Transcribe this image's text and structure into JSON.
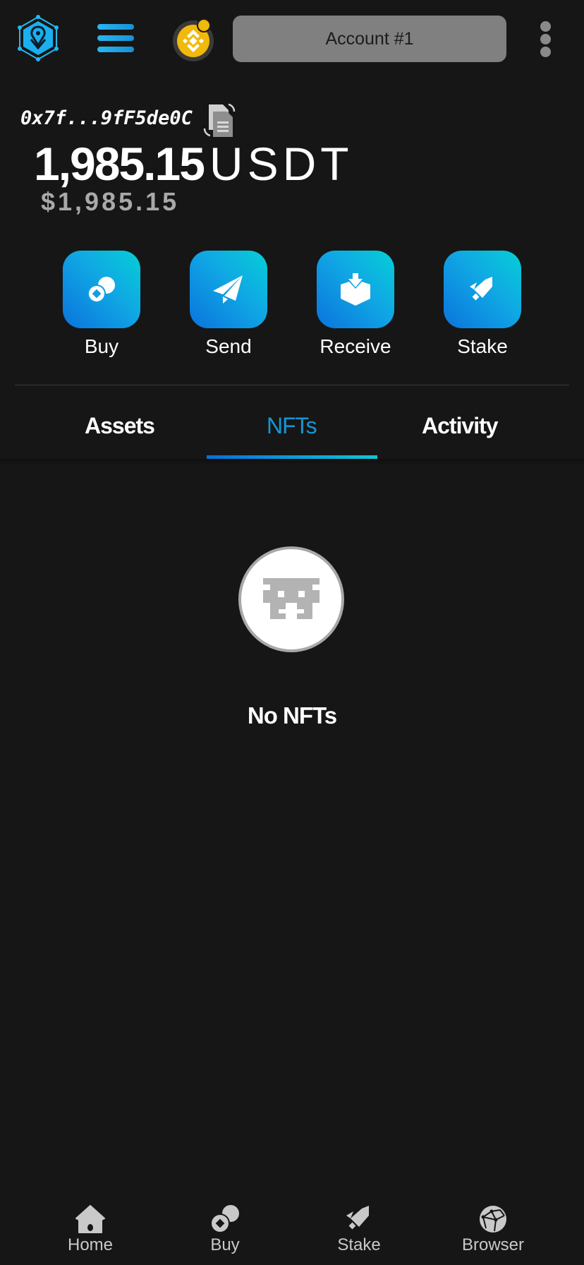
{
  "header": {
    "logo_icon": "location-shield-icon",
    "menu_icon": "hamburger-menu-icon",
    "network": {
      "icon": "binance-icon",
      "color": "#f0b90b"
    },
    "account_label": "Account #1",
    "more_icon": "kebab-menu-icon"
  },
  "wallet": {
    "address": "0x7f...9fF5de0C",
    "copy_icon": "copy-icon",
    "balance_amount": "1,985.15",
    "balance_unit": "USDT",
    "fiat_value": "$1,985.15"
  },
  "actions": [
    {
      "label": "Buy",
      "icon": "coins-icon"
    },
    {
      "label": "Send",
      "icon": "paper-plane-icon"
    },
    {
      "label": "Receive",
      "icon": "inbox-download-icon"
    },
    {
      "label": "Stake",
      "icon": "rocket-icon"
    }
  ],
  "tabs": [
    {
      "label": "Assets",
      "active": false
    },
    {
      "label": "NFTs",
      "active": true
    },
    {
      "label": "Activity",
      "active": false
    }
  ],
  "empty_state": {
    "icon": "space-invader-icon",
    "message": "No NFTs"
  },
  "bottom_nav": [
    {
      "label": "Home",
      "icon": "home-icon"
    },
    {
      "label": "Buy",
      "icon": "coins-icon"
    },
    {
      "label": "Stake",
      "icon": "rocket-icon"
    },
    {
      "label": "Browser",
      "icon": "globe-network-icon"
    }
  ],
  "colors": {
    "background": "#161616",
    "accent": "#1596d6",
    "gradient_start": "#0a74dc",
    "gradient_end": "#05cfd6",
    "account_button": "#808080",
    "muted_text": "#a9a9a9"
  }
}
